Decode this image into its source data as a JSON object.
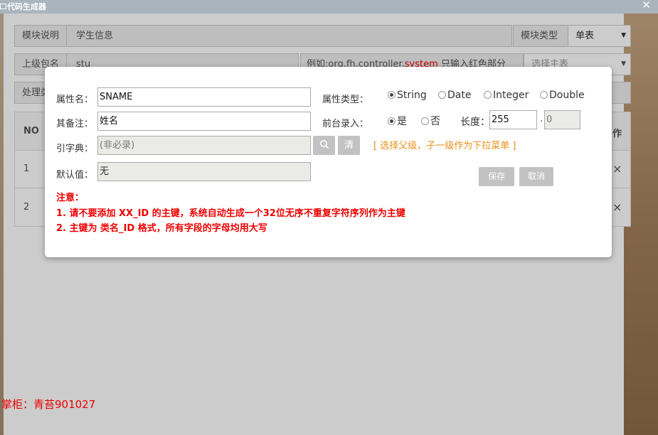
{
  "window": {
    "title": "代码生成器",
    "close": "✕"
  },
  "background": {
    "module_desc_label": "模块说明",
    "module_desc_value": "学生信息",
    "module_type_label": "模块类型",
    "module_type_value": "单表",
    "parent_pkg_label": "上级包名",
    "parent_pkg_value": "stu",
    "example_text": "例如:org.fh.controller.",
    "example_highlight": "system",
    "example_suffix": " 只输入红色部分",
    "master_table_placeholder": "选择主表",
    "process_label": "处理类",
    "table_header_no": "NO",
    "table_header_op": "作",
    "rows": [
      {
        "no": "1",
        "close": "×"
      },
      {
        "no": "2",
        "close": "×"
      }
    ],
    "footer": "掌柜：青苔901027"
  },
  "dialog": {
    "prop_name_label": "属性名：",
    "prop_name_value": "SNAME",
    "prop_type_label": "属性类型：",
    "types": [
      {
        "label": "String",
        "checked": true
      },
      {
        "label": "Date",
        "checked": false
      },
      {
        "label": "Integer",
        "checked": false
      },
      {
        "label": "Double",
        "checked": false
      }
    ],
    "remark_label": "其备注：",
    "remark_value": "姓名",
    "front_input_label": "前台录入：",
    "front_yes": "是",
    "front_no": "否",
    "length_label": "长度：",
    "length_value": "255",
    "dot": ".",
    "decimal_value": "0",
    "dict_label": "引字典：",
    "dict_placeholder": "(非必录)",
    "clear_label": "清",
    "dict_hint": "[ 选择父级，子一级作为下拉菜单 ]",
    "default_label": "默认值：",
    "default_value": "无",
    "save_label": "保存",
    "cancel_label": "取消",
    "note_title": "注意：",
    "note_1": "1. 请不要添加 XX_ID 的主键，系统自动生成一个32位无序不重复字符序列作为主键",
    "note_2": "2. 主键为 类名_ID 格式，所有字段的字母均用大写"
  }
}
